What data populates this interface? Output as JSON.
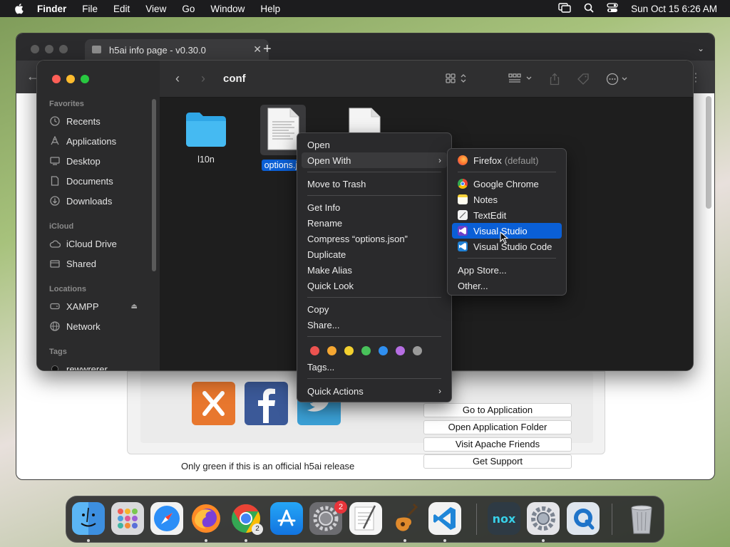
{
  "menubar": {
    "app_name": "Finder",
    "items": [
      "File",
      "Edit",
      "View",
      "Go",
      "Window",
      "Help"
    ],
    "datetime": "Sun Oct 15  6:26 AM"
  },
  "browser": {
    "tab_title": "h5ai info page - v0.30.0",
    "new_tab": "+",
    "buttons": [
      "Go to Application",
      "Open Application Folder",
      "Visit Apache Friends",
      "Get Support"
    ],
    "footer_text": "Only green if this is an official h5ai release"
  },
  "finder": {
    "folder_title": "conf",
    "sidebar": {
      "favorites_label": "Favorites",
      "favorites": [
        "Recents",
        "Applications",
        "Desktop",
        "Documents",
        "Downloads"
      ],
      "icloud_label": "iCloud",
      "icloud": [
        "iCloud Drive",
        "Shared"
      ],
      "locations_label": "Locations",
      "locations": [
        "XAMPP",
        "Network"
      ],
      "tags_label": "Tags",
      "tags": [
        "rewwrerer"
      ]
    },
    "files": [
      {
        "name": "l10n"
      },
      {
        "name": "options.js"
      }
    ]
  },
  "context_menu": {
    "items": {
      "open": "Open",
      "open_with": "Open With",
      "move_to_trash": "Move to Trash",
      "get_info": "Get Info",
      "rename": "Rename",
      "compress": "Compress “options.json”",
      "duplicate": "Duplicate",
      "make_alias": "Make Alias",
      "quick_look": "Quick Look",
      "copy": "Copy",
      "share": "Share...",
      "tags": "Tags...",
      "quick_actions": "Quick Actions"
    },
    "tag_colors": [
      "#ec5350",
      "#f5a732",
      "#f3d02f",
      "#48c15a",
      "#2f8ff0",
      "#b66ee3",
      "#9a9a9a"
    ]
  },
  "open_with_menu": {
    "default_app": "Firefox",
    "default_suffix": "(default)",
    "apps": [
      "Google Chrome",
      "Notes",
      "TextEdit",
      "Visual Studio",
      "Visual Studio Code"
    ],
    "app_store": "App Store...",
    "other": "Other..."
  },
  "dock": {
    "settings_badge": "2",
    "chrome_badge": "2"
  }
}
